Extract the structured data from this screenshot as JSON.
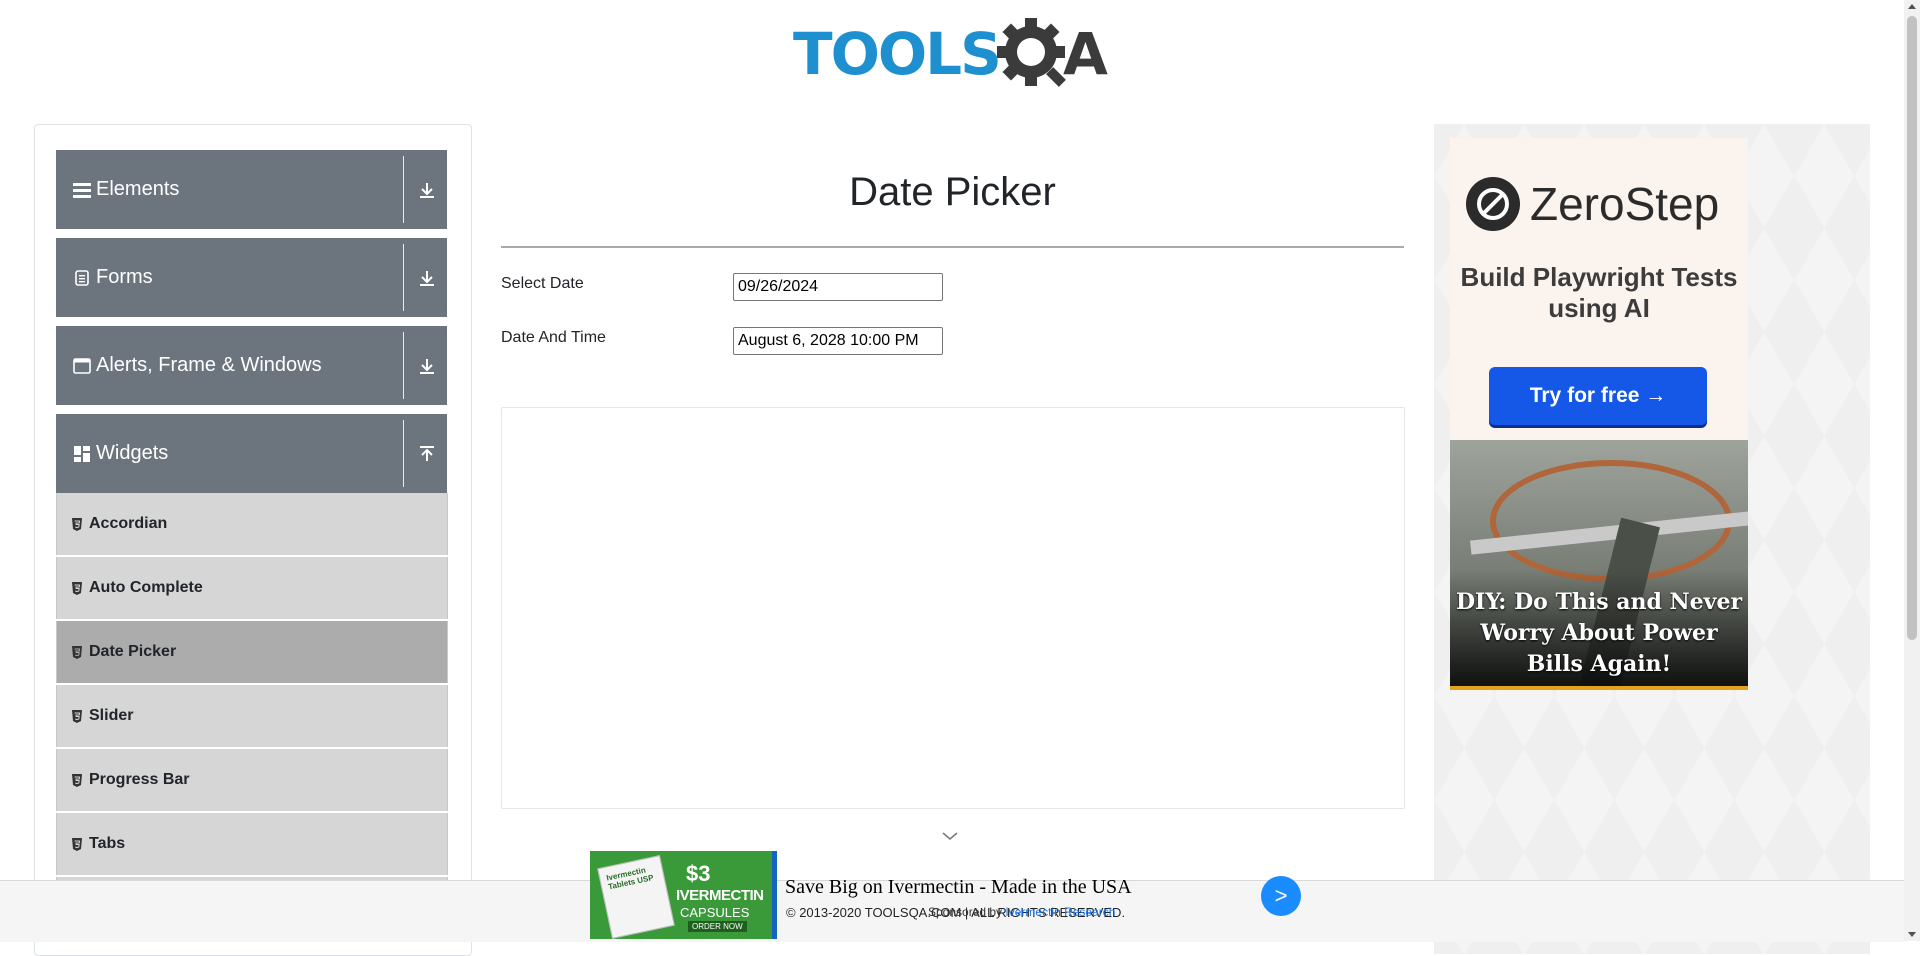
{
  "header": {
    "logo_text_left": "TOOLS",
    "logo_text_right": "A"
  },
  "sidebar": {
    "groups": [
      {
        "label": "Elements",
        "icon": "hamburger-icon",
        "arrow": "download-icon"
      },
      {
        "label": "Forms",
        "icon": "form-icon",
        "arrow": "download-icon"
      },
      {
        "label": "Alerts, Frame & Windows",
        "icon": "window-icon",
        "arrow": "download-icon"
      },
      {
        "label": "Widgets",
        "icon": "dashboard-icon",
        "arrow": "upload-icon"
      }
    ],
    "items": [
      {
        "label": "Accordian",
        "active": false
      },
      {
        "label": "Auto Complete",
        "active": false
      },
      {
        "label": "Date Picker",
        "active": true
      },
      {
        "label": "Slider",
        "active": false
      },
      {
        "label": "Progress Bar",
        "active": false
      },
      {
        "label": "Tabs",
        "active": false
      }
    ]
  },
  "main": {
    "title": "Date Picker",
    "fields": [
      {
        "label": "Select Date",
        "value": "09/26/2024"
      },
      {
        "label": "Date And Time",
        "value": "August 6, 2028 10:00 PM"
      }
    ]
  },
  "right_ad": {
    "brand": "ZeroStep",
    "tagline": "Build Playwright Tests using AI",
    "cta": "Try for free →",
    "story": "DIY: Do This and Never Worry About Power Bills Again!"
  },
  "bottom_ad": {
    "price": "$3",
    "product": "IVERMECTIN",
    "product_sub": "CAPSULES",
    "order": "ORDER NOW",
    "box_label": "Ivermectin Tablets USP",
    "headline": "Save Big on Ivermectin - Made in the USA",
    "button": ">"
  },
  "footer": {
    "copyright": "© 2013-2020 TOOLSQA.COM | ALL RIGHTS RESERVED.",
    "overlay_prefix": "Sponsored by",
    "overlay_link": "Ivermectin Research"
  },
  "colors": {
    "group_bg": "#6c757d",
    "item_bg": "#d6d6d6",
    "item_active_bg": "#acacac",
    "logo_blue": "#1e90d0",
    "cta_blue": "#1558e8"
  }
}
